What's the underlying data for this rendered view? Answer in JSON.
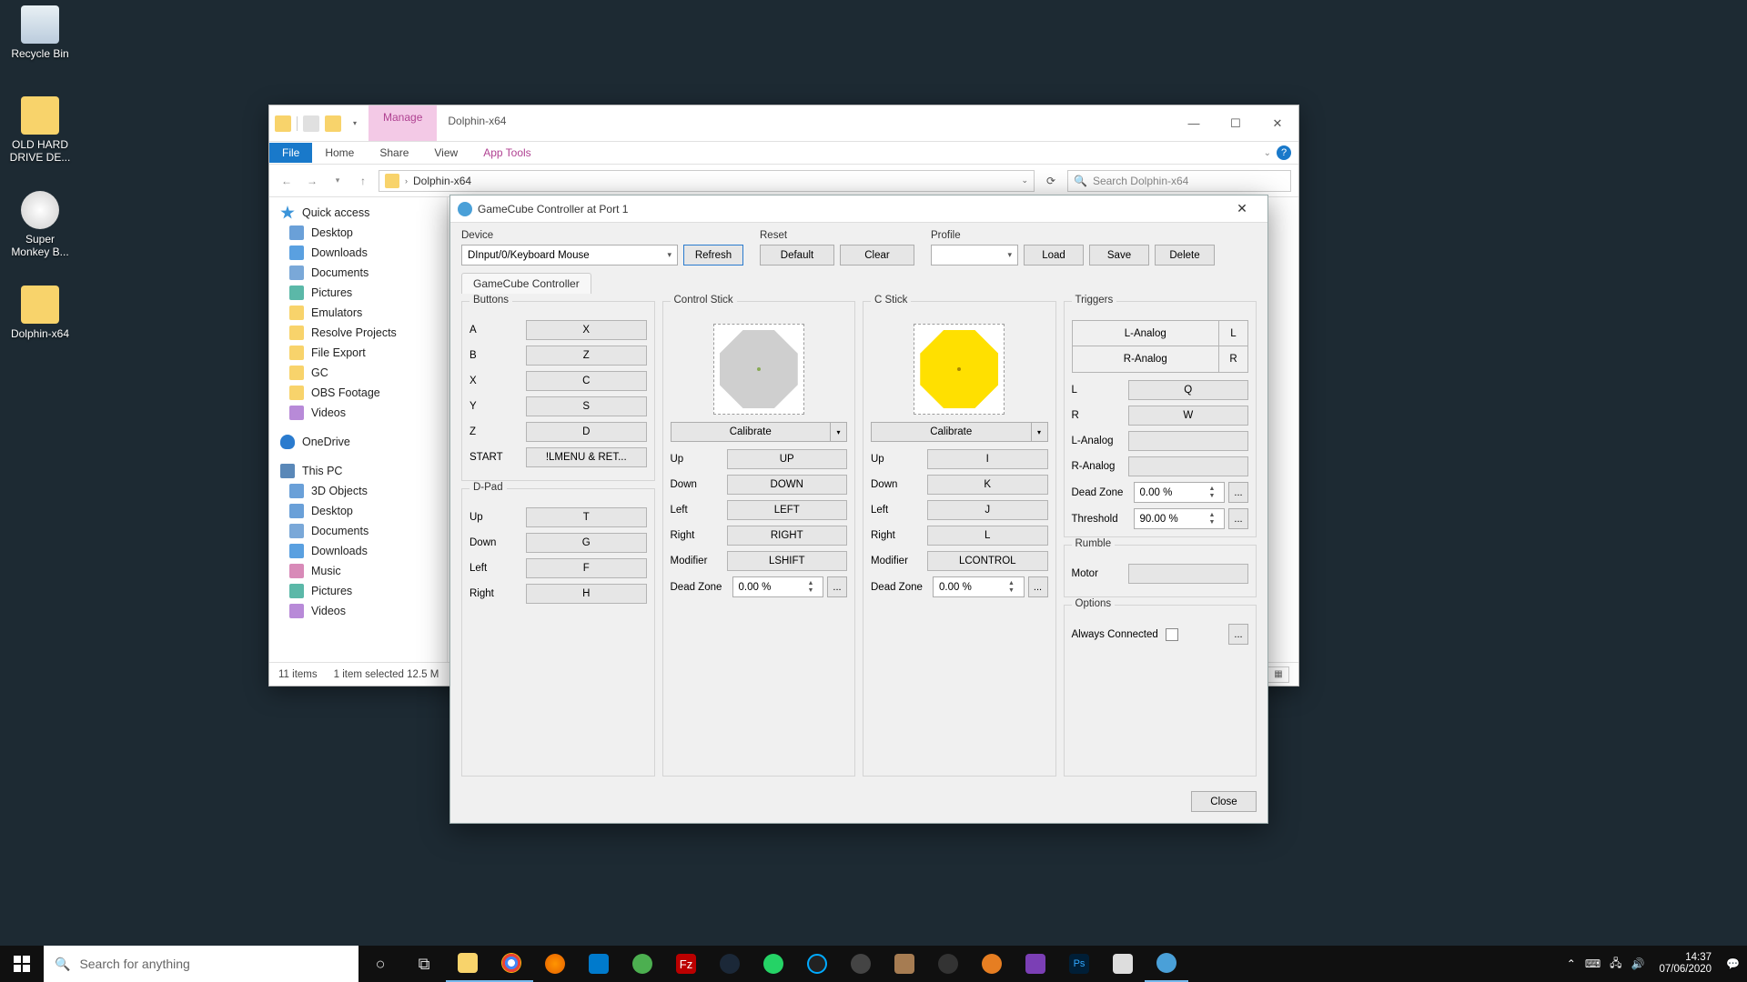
{
  "desktop": {
    "icons": [
      {
        "label": "Recycle Bin"
      },
      {
        "label": "OLD HARD DRIVE DE..."
      },
      {
        "label": "Super Monkey B..."
      },
      {
        "label": "Dolphin-x64"
      }
    ]
  },
  "explorer": {
    "ribbon_context": "Manage",
    "title": "Dolphin-x64",
    "tabs": {
      "file": "File",
      "home": "Home",
      "share": "Share",
      "view": "View",
      "apptools": "App Tools"
    },
    "path_segment": "Dolphin-x64",
    "search_placeholder": "Search Dolphin-x64",
    "nav": {
      "quick_access": "Quick access",
      "items1": [
        "Desktop",
        "Downloads",
        "Documents",
        "Pictures",
        "Emulators",
        "Resolve Projects",
        "File Export",
        "GC",
        "OBS Footage",
        "Videos"
      ],
      "onedrive": "OneDrive",
      "thispc": "This PC",
      "items2": [
        "3D Objects",
        "Desktop",
        "Documents",
        "Downloads",
        "Music",
        "Pictures",
        "Videos"
      ]
    },
    "status": {
      "items": "11 items",
      "selected": "1 item selected  12.5 M"
    }
  },
  "dialog": {
    "title": "GameCube Controller at Port 1",
    "device": {
      "label": "Device",
      "value": "DInput/0/Keyboard Mouse",
      "refresh": "Refresh"
    },
    "reset": {
      "label": "Reset",
      "default": "Default",
      "clear": "Clear"
    },
    "profile": {
      "label": "Profile",
      "value": "",
      "load": "Load",
      "save": "Save",
      "delete": "Delete"
    },
    "tab": "GameCube Controller",
    "buttons": {
      "legend": "Buttons",
      "rows": [
        {
          "lbl": "A",
          "val": "X"
        },
        {
          "lbl": "B",
          "val": "Z"
        },
        {
          "lbl": "X",
          "val": "C"
        },
        {
          "lbl": "Y",
          "val": "S"
        },
        {
          "lbl": "Z",
          "val": "D"
        },
        {
          "lbl": "START",
          "val": "!LMENU & RET..."
        }
      ]
    },
    "dpad": {
      "legend": "D-Pad",
      "rows": [
        {
          "lbl": "Up",
          "val": "T"
        },
        {
          "lbl": "Down",
          "val": "G"
        },
        {
          "lbl": "Left",
          "val": "F"
        },
        {
          "lbl": "Right",
          "val": "H"
        }
      ]
    },
    "control_stick": {
      "legend": "Control Stick",
      "calibrate": "Calibrate",
      "rows": [
        {
          "lbl": "Up",
          "val": "UP"
        },
        {
          "lbl": "Down",
          "val": "DOWN"
        },
        {
          "lbl": "Left",
          "val": "LEFT"
        },
        {
          "lbl": "Right",
          "val": "RIGHT"
        },
        {
          "lbl": "Modifier",
          "val": "LSHIFT"
        }
      ],
      "deadzone_label": "Dead Zone",
      "deadzone": "0.00 %"
    },
    "c_stick": {
      "legend": "C Stick",
      "calibrate": "Calibrate",
      "rows": [
        {
          "lbl": "Up",
          "val": "I"
        },
        {
          "lbl": "Down",
          "val": "K"
        },
        {
          "lbl": "Left",
          "val": "J"
        },
        {
          "lbl": "Right",
          "val": "L"
        },
        {
          "lbl": "Modifier",
          "val": "LCONTROL"
        }
      ],
      "deadzone_label": "Dead Zone",
      "deadzone": "0.00 %"
    },
    "triggers": {
      "legend": "Triggers",
      "table": [
        {
          "big": "L-Analog",
          "small": "L"
        },
        {
          "big": "R-Analog",
          "small": "R"
        }
      ],
      "rows": [
        {
          "lbl": "L",
          "val": "Q"
        },
        {
          "lbl": "R",
          "val": "W"
        },
        {
          "lbl": "L-Analog",
          "val": ""
        },
        {
          "lbl": "R-Analog",
          "val": ""
        }
      ],
      "deadzone_label": "Dead Zone",
      "deadzone": "0.00 %",
      "threshold_label": "Threshold",
      "threshold": "90.00 %"
    },
    "rumble": {
      "legend": "Rumble",
      "motor_label": "Motor",
      "motor": ""
    },
    "options": {
      "legend": "Options",
      "always_connected": "Always Connected"
    },
    "close": "Close"
  },
  "taskbar": {
    "search_placeholder": "Search for anything",
    "time": "14:37",
    "date": "07/06/2020"
  }
}
